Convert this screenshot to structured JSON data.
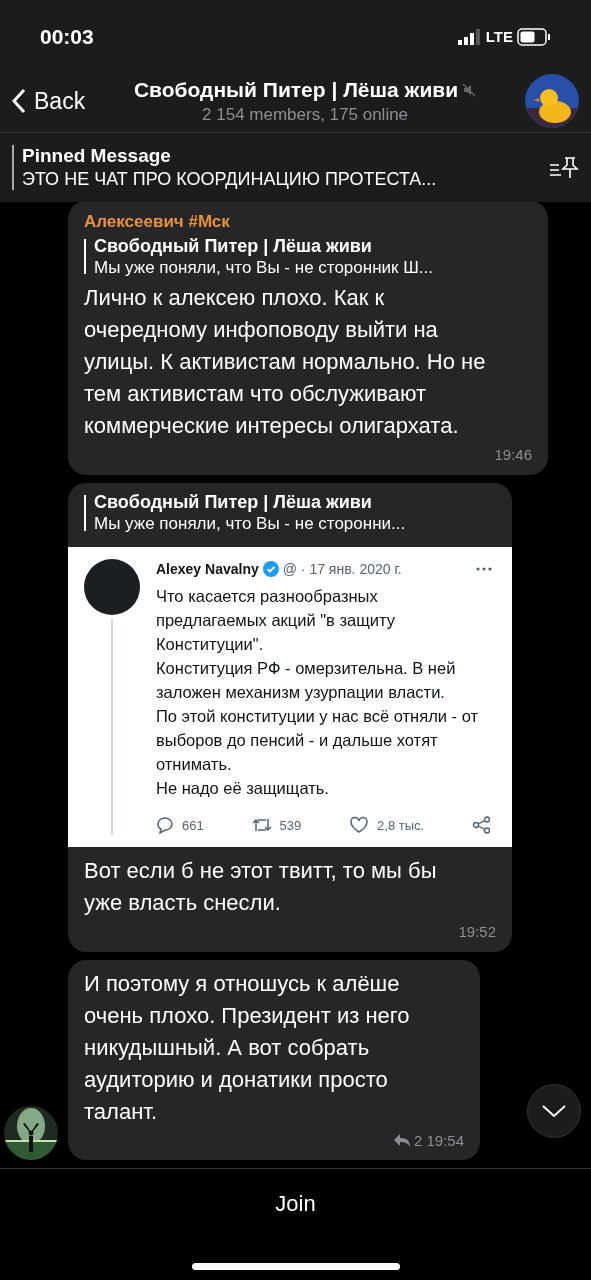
{
  "status_bar": {
    "time": "00:03",
    "network": "LTE"
  },
  "header": {
    "back": "Back",
    "title": "Свободный Питер | Лёша живи",
    "muted": true,
    "subtitle": "2 154 members, 175 online"
  },
  "pinned": {
    "label": "Pinned Message",
    "text": "ЭТО НЕ ЧАТ ПРО КООРДИНАЦИЮ ПРОТЕСТА..."
  },
  "messages": [
    {
      "kind": "text",
      "sender": "Алексеевич #Мск",
      "reply": {
        "author": "Свободный Питер | Лёша живи",
        "text": "Мы уже поняли, что Вы - не сторонник Ш..."
      },
      "text": "Лично к алексею плохо. Как к очередному инфоповоду выйти на улицы. К активистам нормально. Но не тем активистам что обслуживают коммерческие интересы олигархата.",
      "time": "19:46"
    },
    {
      "kind": "tweet",
      "reply": {
        "author": "Свободный Питер | Лёша живи",
        "text": "Мы уже поняли, что Вы - не сторонни..."
      },
      "tweet": {
        "author": "Alexey Navalny",
        "verified": true,
        "meta": "@ · 17 янв. 2020 г.",
        "paragraphs": [
          "Что касается разнообразных предлагаемых акций \"в защиту Конституции\".",
          "Конституция РФ - омерзительна. В ней заложен механизм узурпации власти.",
          "По этой конституции у нас всё отняли - от выборов до пенсий - и дальше хотят отнимать.",
          "Не надо её защищать."
        ],
        "replies": "661",
        "retweets": "539",
        "likes": "2,8 тыс."
      },
      "text": "Вот если б не этот твитт, то мы бы уже власть снесли.",
      "time": "19:52"
    },
    {
      "kind": "text",
      "avatar": true,
      "text": "И поэтому я отношусь к алёше очень плохо. Президент из него никудышный. А вот собрать аудиторию и донатики просто талант.",
      "reply_count": "2",
      "time": "19:54"
    }
  ],
  "join_button": "Join"
}
